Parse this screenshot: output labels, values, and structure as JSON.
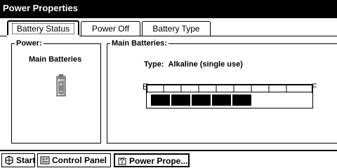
{
  "window": {
    "title": "Power Properties"
  },
  "tabs": [
    {
      "label": "Battery Status",
      "active": true
    },
    {
      "label": "Power Off",
      "active": false
    },
    {
      "label": "Battery Type",
      "active": false
    }
  ],
  "power_group": {
    "legend": "Power:",
    "battery_label": "Main Batteries"
  },
  "main_batteries_group": {
    "legend": "Main Batteries:",
    "type_label": "Type:",
    "type_value": "Alkaline (single use)",
    "gauge": {
      "empty_label": "E",
      "full_label": "F",
      "segments_filled": 5,
      "segments_total": 8
    }
  },
  "taskbar": {
    "start_label": "Start",
    "control_panel_label": "Control Panel",
    "power_props_label": "Power Prope..."
  },
  "icons": {
    "battery": "battery-icon",
    "start": "start-icon",
    "control_panel": "control-panel-icon",
    "power": "power-properties-icon"
  }
}
